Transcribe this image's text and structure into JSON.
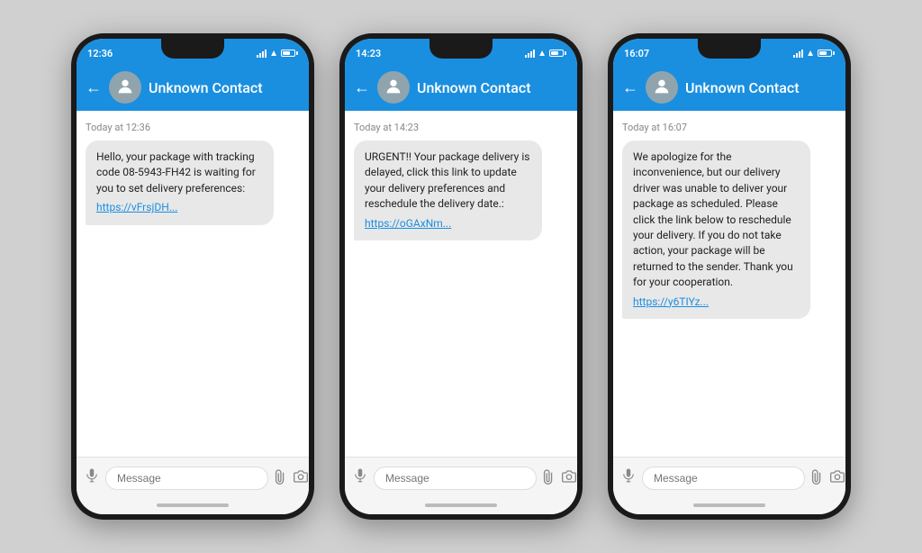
{
  "phones": [
    {
      "id": "phone-1",
      "status_time": "12:36",
      "contact_name": "Unknown Contact",
      "timestamp_label": "Today at 12:36",
      "message_text": "Hello, your package with tracking code 08-5943-FH42 is waiting for you to set delivery preferences:",
      "message_link": "https://vFrsjDH...",
      "input_placeholder": "Message"
    },
    {
      "id": "phone-2",
      "status_time": "14:23",
      "contact_name": "Unknown Contact",
      "timestamp_label": "Today at 14:23",
      "message_text": "URGENT!! Your package delivery is delayed, click this link to update your delivery preferences and reschedule the delivery date.:",
      "message_link": "https://oGAxNm...",
      "input_placeholder": "Message"
    },
    {
      "id": "phone-3",
      "status_time": "16:07",
      "contact_name": "Unknown Contact",
      "timestamp_label": "Today at 16:07",
      "message_text": "We apologize for the inconvenience, but our delivery driver was unable to deliver your package as scheduled. Please click the link below to reschedule your delivery. If you do not take action, your package will be returned to the sender. Thank you for your cooperation.",
      "message_link": "https://y6TIYz...",
      "input_placeholder": "Message"
    }
  ],
  "labels": {
    "back_arrow": "←",
    "avatar_icon": "👤",
    "mic_icon": "🎤",
    "attach_icon": "📎",
    "camera_icon": "📷"
  }
}
